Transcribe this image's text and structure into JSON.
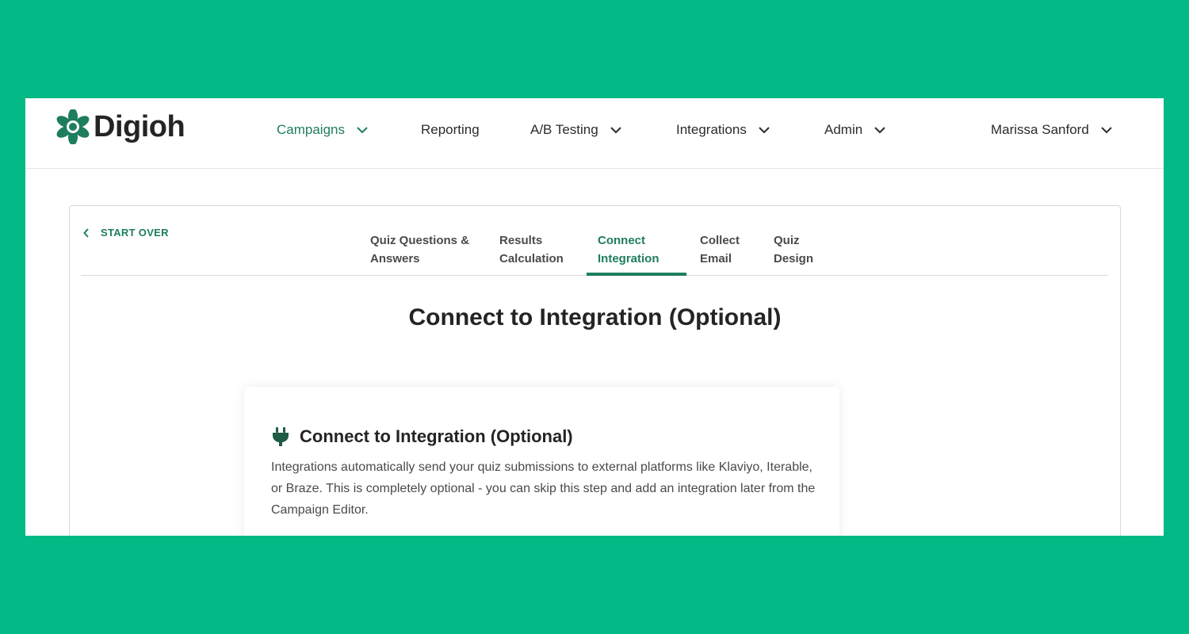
{
  "brand": {
    "name": "Digioh",
    "accent": "#1e7d5f",
    "background": "#03b985"
  },
  "nav": {
    "items": [
      {
        "label": "Campaigns",
        "has_dropdown": true,
        "active": true
      },
      {
        "label": "Reporting",
        "has_dropdown": false,
        "active": false
      },
      {
        "label": "A/B Testing",
        "has_dropdown": true,
        "active": false
      },
      {
        "label": "Integrations",
        "has_dropdown": true,
        "active": false
      },
      {
        "label": "Admin",
        "has_dropdown": true,
        "active": false
      }
    ],
    "user": "Marissa Sanford"
  },
  "wizard": {
    "start_over": "START OVER",
    "steps": [
      {
        "line1": "Quiz Questions &",
        "line2": "Answers",
        "active": false
      },
      {
        "line1": "Results",
        "line2": "Calculation",
        "active": false
      },
      {
        "line1": "Connect",
        "line2": "Integration",
        "active": true
      },
      {
        "line1": "Collect",
        "line2": "Email",
        "active": false
      },
      {
        "line1": "Quiz",
        "line2": "Design",
        "active": false
      }
    ],
    "page_title": "Connect to Integration (Optional)"
  },
  "card": {
    "icon": "plug-icon",
    "title": "Connect to Integration (Optional)",
    "description": "Integrations automatically send your quiz submissions to external platforms like Klaviyo, Iterable, or Braze. This is completely optional - you can skip this step and add an integration later from the Campaign Editor."
  }
}
